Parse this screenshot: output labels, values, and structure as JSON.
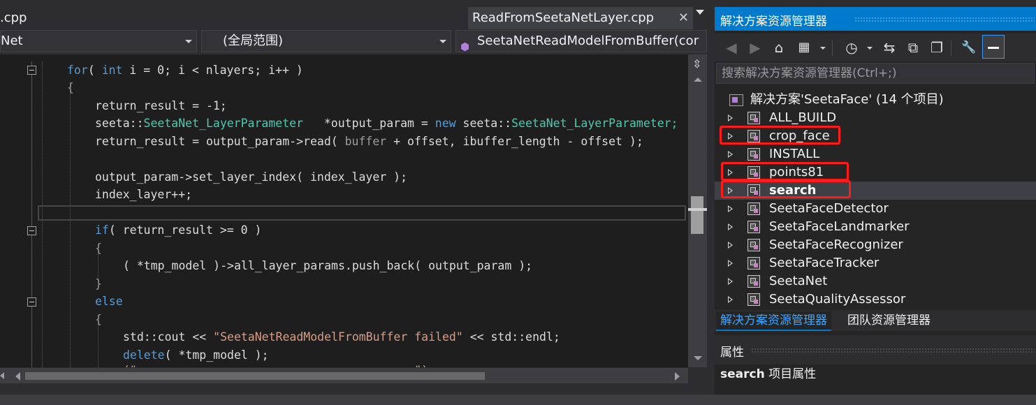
{
  "editor": {
    "tabs": {
      "left": ".cpp",
      "active": "ReadFromSeetaNetLayer.cpp",
      "close": "✕"
    },
    "nav": {
      "project": "Net",
      "scope": "(全局范围)",
      "function": "SeetaNetReadModelFromBuffer(cor"
    },
    "code": {
      "l1": {
        "a": "for",
        "b": "( ",
        "c": "int",
        "d": " i = 0; i < nlayers; i++ )"
      },
      "l2": "{",
      "l3": "return_result = -1;",
      "l4": {
        "a": "seeta::",
        "b": "SeetaNet_LayerParameter",
        "c": "   *output_param = ",
        "d": "new",
        "e": " seeta::",
        "f": "SeetaNet_LayerParameter;"
      },
      "l5": {
        "a": "return_result = output_param->read( ",
        "b": "buffer",
        "c": " + offset, ibuffer_length - offset );"
      },
      "l7": "output_param->set_layer_index( index_layer );",
      "l8": "index_layer++;",
      "l10": {
        "a": "if",
        "b": "( return_result >= 0 )"
      },
      "l11": "{",
      "l12": "( *tmp_model )->all_layer_params.push_back( output_param );",
      "l13": "}",
      "l14": "else",
      "l15": "{",
      "l16": {
        "a": "std::cout << ",
        "b": "\"SeetaNetReadModelFromBuffer failed\"",
        "c": " << std::endl;"
      },
      "l17": {
        "a": "delete",
        "b": "( *tmp_model );"
      },
      "l18": {
        "a": "",
        "b": "(\"                                        \")"
      }
    }
  },
  "solution_explorer": {
    "title": "解决方案资源管理器",
    "search_placeholder": "搜索解决方案资源管理器(Ctrl+;)",
    "solution_label": "解决方案'SeetaFace' (14 个项目)",
    "projects": [
      "ALL_BUILD",
      "crop_face",
      "INSTALL",
      "points81",
      "search",
      "SeetaFaceDetector",
      "SeetaFaceLandmarker",
      "SeetaFaceRecognizer",
      "SeetaFaceTracker",
      "SeetaNet",
      "SeetaQualityAssessor"
    ],
    "selected_project": "search",
    "highlighted_projects": [
      "crop_face",
      "points81",
      "search"
    ],
    "bottom_tabs": [
      "解决方案资源管理器",
      "团队资源管理器"
    ]
  },
  "properties": {
    "title": "属性",
    "target_name": "search",
    "target_suffix": " 项目属性"
  },
  "colors": {
    "accent": "#007acc",
    "highlight_box": "#ff1a1a",
    "keyword": "#569cd6",
    "type": "#4ec9b0",
    "string": "#d69d85"
  },
  "icons": {
    "back": "◀",
    "forward": "▶",
    "home": "⌂",
    "sync": "⇆",
    "history": "◷",
    "collapse": "⧉",
    "copy": "❐",
    "wrench": "🔧"
  }
}
